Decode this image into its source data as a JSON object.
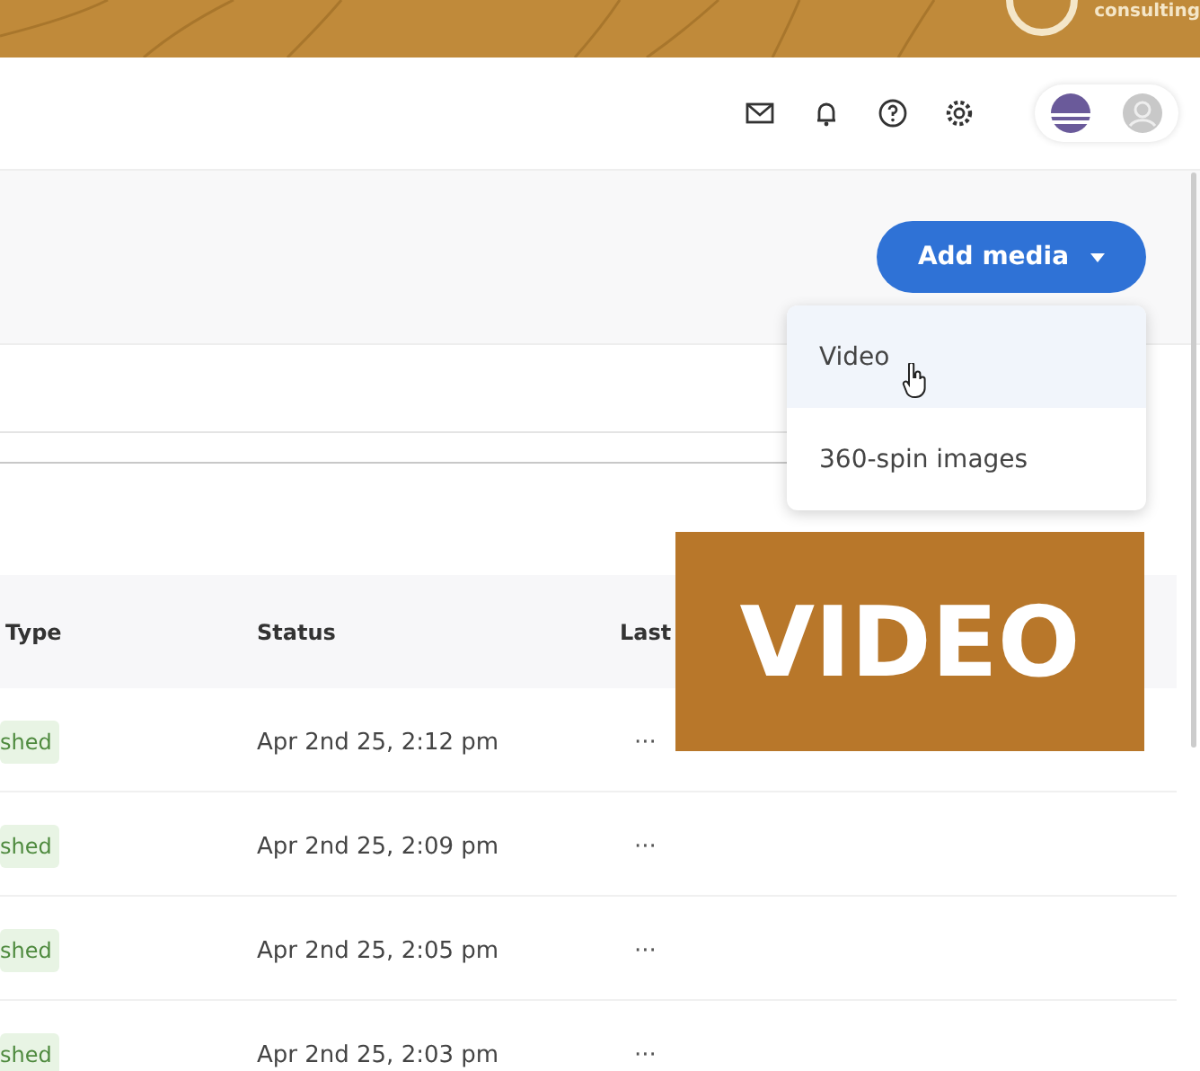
{
  "banner": {
    "logo_text": "consulting"
  },
  "add_media": {
    "label": "Add media",
    "menu": [
      {
        "label": "Video",
        "selected": true
      },
      {
        "label": "360-spin images",
        "selected": false
      }
    ]
  },
  "table": {
    "columns": [
      "Type",
      "Status",
      "Last"
    ],
    "rows": [
      {
        "type": "shed",
        "status": "Apr 2nd 25, 2:12 pm",
        "actions": "···"
      },
      {
        "type": "shed",
        "status": "Apr 2nd 25, 2:09 pm",
        "actions": "···"
      },
      {
        "type": "shed",
        "status": "Apr 2nd 25, 2:05 pm",
        "actions": "···"
      },
      {
        "type": "shed",
        "status": "Apr 2nd 25, 2:03 pm",
        "actions": "···"
      }
    ]
  },
  "overlay": {
    "text": "VIDEO"
  }
}
